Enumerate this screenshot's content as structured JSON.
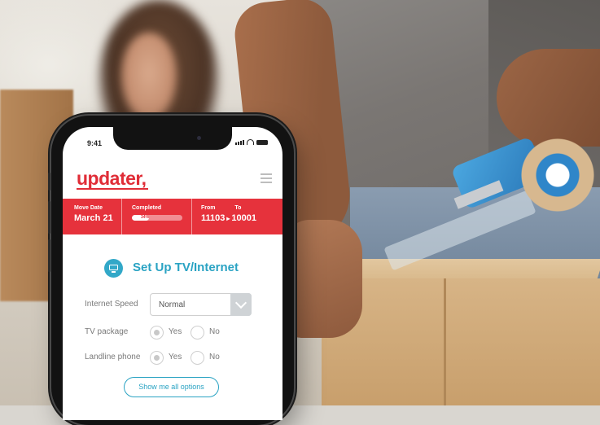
{
  "status_bar": {
    "time": "9:41"
  },
  "app": {
    "logo": "updater,"
  },
  "banner": {
    "move_date_label": "Move Date",
    "move_date_value": "March 21",
    "completed_label": "Completed",
    "completed_percent_text": "34%",
    "completed_progress": 0.34,
    "from_label": "From",
    "from_value": "11103",
    "to_label": "To",
    "to_value": "10001",
    "arrow": "▸"
  },
  "section": {
    "title": "Set Up TV/Internet",
    "icon": "tv-icon"
  },
  "form": {
    "internet_speed_label": "Internet Speed",
    "internet_speed_value": "Normal",
    "tv_package_label": "TV package",
    "landline_label": "Landline phone",
    "yes_label": "Yes",
    "no_label": "No"
  },
  "show_all_button": "Show me all options",
  "colors": {
    "brand_red": "#e02d37",
    "banner_red": "#e6323c",
    "accent_teal": "#2aa3c3"
  }
}
